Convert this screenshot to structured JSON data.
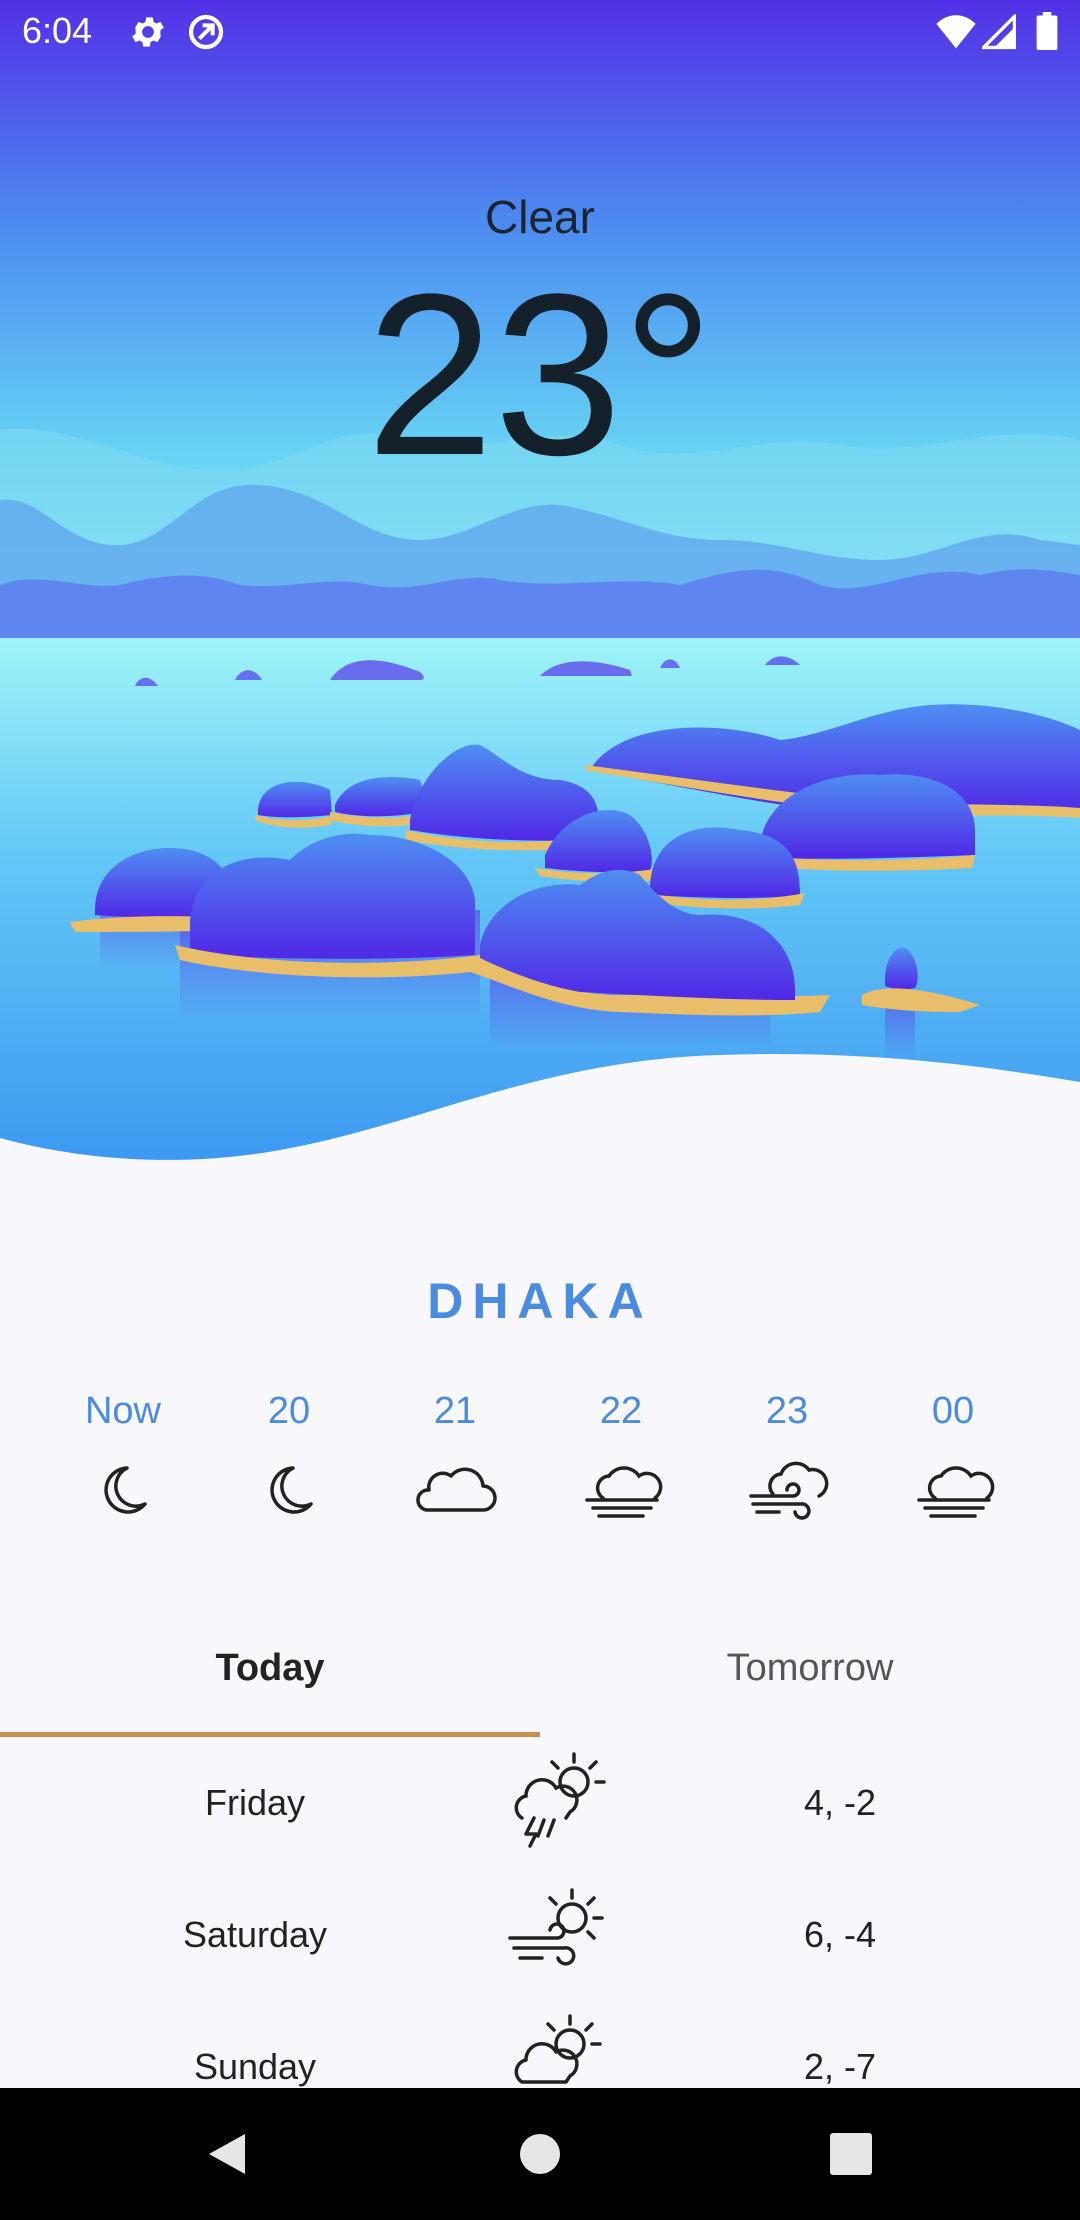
{
  "status_bar": {
    "time": "6:04",
    "icons_left": [
      "gear-icon",
      "sync-icon"
    ],
    "icons_right": [
      "wifi-icon",
      "signal-icon",
      "battery-icon"
    ]
  },
  "current": {
    "condition": "Clear",
    "temperature": "23°"
  },
  "city": "DHAKA",
  "hourly": [
    {
      "label": "Now",
      "icon": "moon-icon"
    },
    {
      "label": "20",
      "icon": "moon-icon"
    },
    {
      "label": "21",
      "icon": "cloud-icon"
    },
    {
      "label": "22",
      "icon": "fog-cloud-icon"
    },
    {
      "label": "23",
      "icon": "wind-cloud-icon"
    },
    {
      "label": "00",
      "icon": "fog-cloud-icon"
    }
  ],
  "tabs": [
    {
      "label": "Today",
      "selected": true
    },
    {
      "label": "Tomorrow",
      "selected": false
    }
  ],
  "daily": [
    {
      "day": "Friday",
      "icon": "thunderstorm-sun-icon",
      "temp": "4, -2"
    },
    {
      "day": "Saturday",
      "icon": "windy-sun-icon",
      "temp": "6, -4"
    },
    {
      "day": "Sunday",
      "icon": "cloudy-sun-icon",
      "temp": "2, -7"
    }
  ],
  "colors": {
    "accent": "#4A8BE0",
    "tab_indicator": "#C8904A",
    "sky_top": "#5230E6",
    "background": "#F8F8FC"
  }
}
